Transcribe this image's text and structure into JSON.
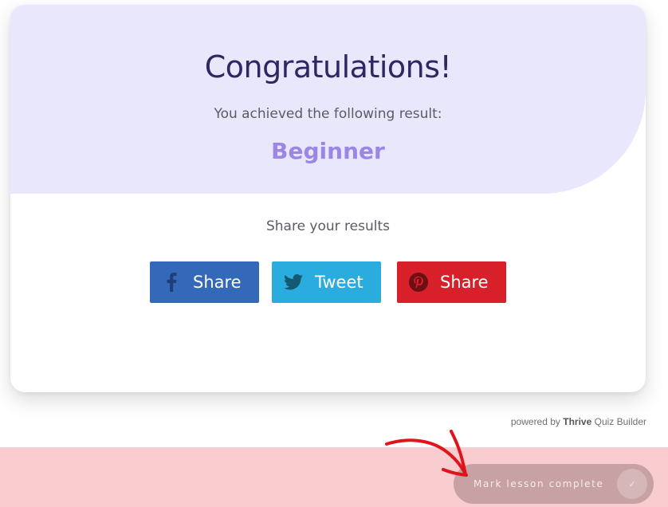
{
  "quiz": {
    "title": "Congratulations!",
    "subtitle": "You achieved the following result:",
    "result": "Beginner",
    "share_heading": "Share your results"
  },
  "share_buttons": [
    {
      "network": "facebook",
      "icon": "facebook-icon",
      "label": "Share",
      "color": "#3468b8"
    },
    {
      "network": "twitter",
      "icon": "twitter-icon",
      "label": "Tweet",
      "color": "#2aacdf"
    },
    {
      "network": "pinterest",
      "icon": "pinterest-icon",
      "label": "Share",
      "color": "#d7202a"
    }
  ],
  "footer": {
    "powered_prefix": "powered by",
    "brand": "Thrive",
    "product": "Quiz Builder"
  },
  "lesson": {
    "mark_complete_label": "Mark lesson complete",
    "check_icon": "check-icon",
    "bar_color": "#f9cdd0"
  },
  "colors": {
    "hero_background": "#e9e7fb",
    "title": "#2d2763",
    "result": "#9b86e6",
    "annotation_arrow": "#e0141c"
  }
}
